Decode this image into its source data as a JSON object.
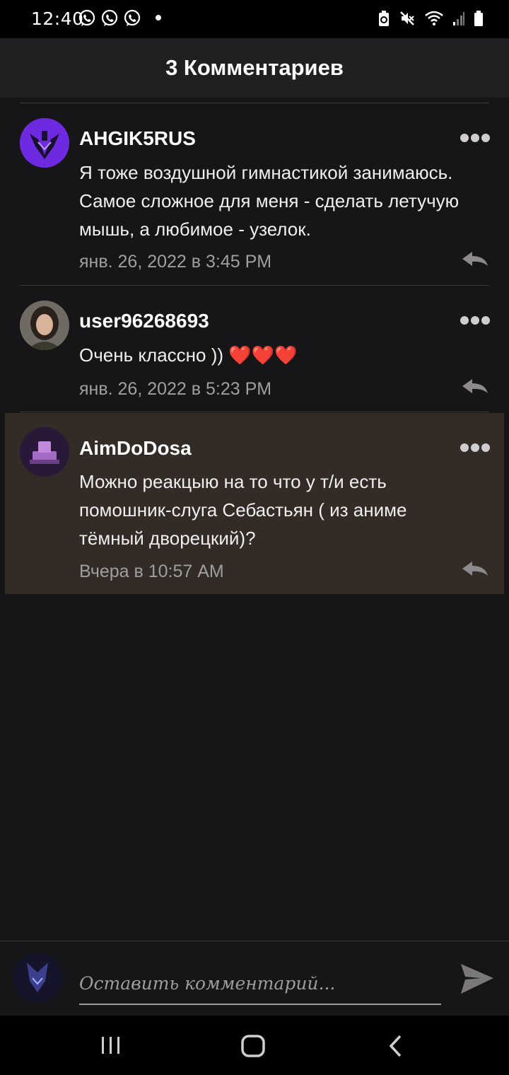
{
  "status_bar": {
    "time": "12:40",
    "left_icons": [
      "viber-icon",
      "viber-icon",
      "viber-icon",
      "dot-icon"
    ],
    "right_icons": [
      "battery-saver-icon",
      "mute-icon",
      "wifi-icon",
      "signal-icon",
      "battery-icon"
    ]
  },
  "header": {
    "title": "3 Комментариев"
  },
  "comments": [
    {
      "username": "AHGIK5RUS",
      "text_lines": [
        "Я тоже воздушной гимнастикой занимаюсь.",
        "Самое сложное для меня - сделать летучую",
        "мышь, а любимое - узелок."
      ],
      "timestamp": "янв. 26, 2022 в 3:45 PM",
      "avatar": "avatar-purple-robot",
      "highlighted": false
    },
    {
      "username": "user96268693",
      "text_lines": [
        "Очень классно )) ❤️❤️❤️"
      ],
      "timestamp": "янв. 26, 2022 в 5:23 PM",
      "avatar": "avatar-photo-girl",
      "highlighted": false
    },
    {
      "username": "AimDoDosa",
      "text_lines": [
        "Можно реакцыю на то что у т/и есть",
        "помошник-слуга Себастьян ( из аниме",
        "тёмный дворецкий)?"
      ],
      "timestamp": "Вчера в 10:57 AM",
      "avatar": "avatar-purple-machine",
      "highlighted": true
    }
  ],
  "composer": {
    "placeholder": "Оставить комментарий..."
  },
  "nav": [
    "recent-apps-icon",
    "home-icon",
    "back-icon"
  ],
  "colors": {
    "background": "#161517",
    "header": "#202022",
    "highlight": "#332b26",
    "muted_text": "#a09ea1"
  }
}
